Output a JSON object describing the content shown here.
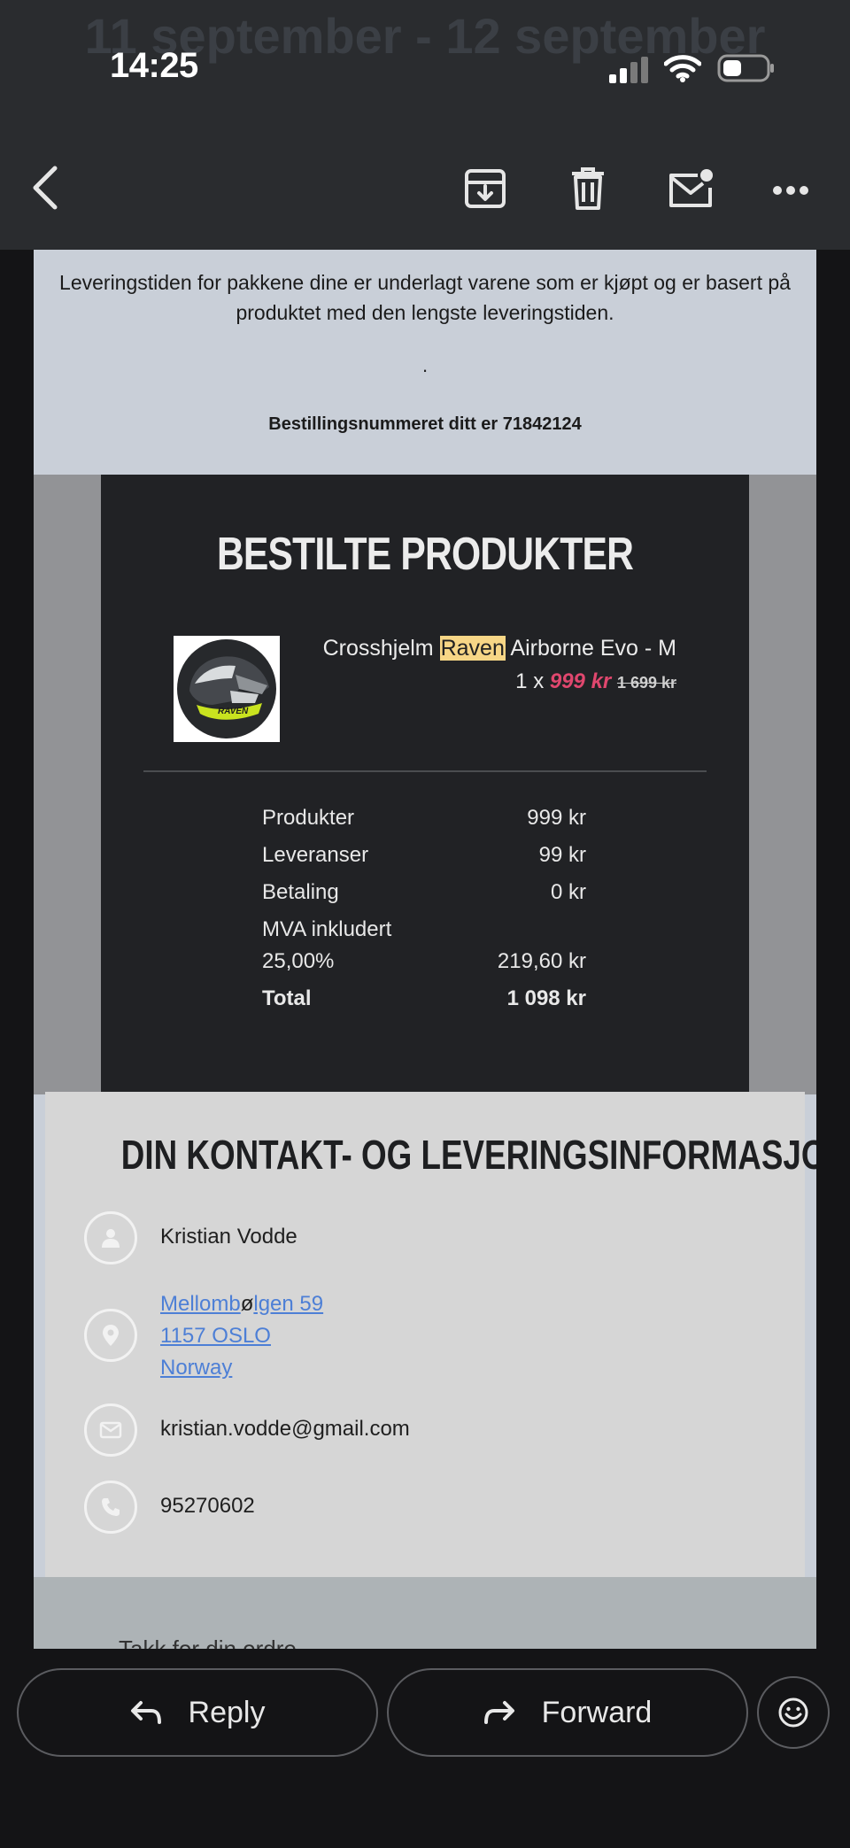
{
  "status_bar": {
    "time": "14:25"
  },
  "toolbar": {
    "back": "back-icon",
    "archive": "archive-icon",
    "delete": "trash-icon",
    "mark_unread": "mail-unread-icon",
    "more": "more-icon"
  },
  "email": {
    "ghost_date": "11 september - 12 september",
    "delivery_note": "Leveringstiden for pakkene dine er underlagt varene som er kjøpt og er basert på produktet med den lengste leveringstiden.",
    "dot": ".",
    "order_number_text": "Bestillingsnummeret ditt er 71842124",
    "products": {
      "title": "BESTILTE PRODUKTER",
      "item": {
        "name_prefix": "Crosshjelm ",
        "name_highlight": "Raven",
        "name_suffix": " Airborne Evo - M",
        "qty": "1 x ",
        "sale_price": "999 kr",
        "old_price": "1 699 kr",
        "image_text": "RAVEN"
      },
      "summary": [
        {
          "label": "Produkter",
          "value": "999 kr"
        },
        {
          "label": "Leveranser",
          "value": "99 kr"
        },
        {
          "label": "Betaling",
          "value": "0 kr"
        },
        {
          "label": "MVA inkludert 25,00%",
          "value": "219,60 kr"
        },
        {
          "label": "Total",
          "value": "1 098 kr"
        }
      ]
    },
    "contact": {
      "title": "DIN KONTAKT- OG LEVERINGSINFORMASJON",
      "name": "Kristian Vodde",
      "address_line1_a": "Mellomb",
      "address_line1_b": "ø",
      "address_line1_c": "lgen 59",
      "address_line2": "1157 OSLO",
      "address_line3": "Norway",
      "email": "kristian.vodde@gmail.com",
      "phone": "95270602"
    },
    "cutoff_text": "Takk for din ordre"
  },
  "actions": {
    "reply": "Reply",
    "forward": "Forward"
  },
  "colors": {
    "sale": "#e0476e",
    "link": "#4d7fd6",
    "highlight": "#f7d686"
  }
}
